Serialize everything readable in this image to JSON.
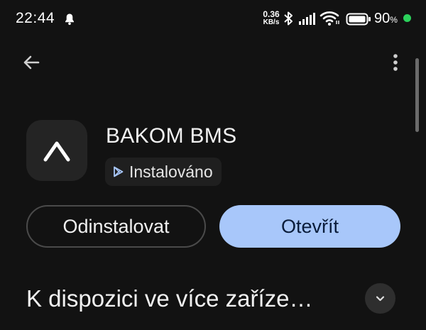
{
  "status_bar": {
    "time": "22:44",
    "net_speed_value": "0.36",
    "net_speed_unit": "KB/s",
    "battery_value": "90",
    "battery_unit": "%",
    "battery_dot_color": "#2bd15b",
    "icons": [
      "bell-icon",
      "bluetooth-icon",
      "signal-icon",
      "wifi-icon",
      "battery-icon"
    ]
  },
  "app_bar": {
    "back_icon": "arrow-back-icon",
    "more_icon": "more-vert-icon"
  },
  "app": {
    "name": "BAKOM BMS",
    "status_label": "Instalováno",
    "icon": "app-logo-chevron-up-icon"
  },
  "actions": {
    "uninstall_label": "Odinstalovat",
    "open_label": "Otevřít",
    "open_color": "#a8c7fa"
  },
  "section": {
    "title": "K dispozici ve více zaříze…",
    "expand_icon": "chevron-down-icon"
  }
}
